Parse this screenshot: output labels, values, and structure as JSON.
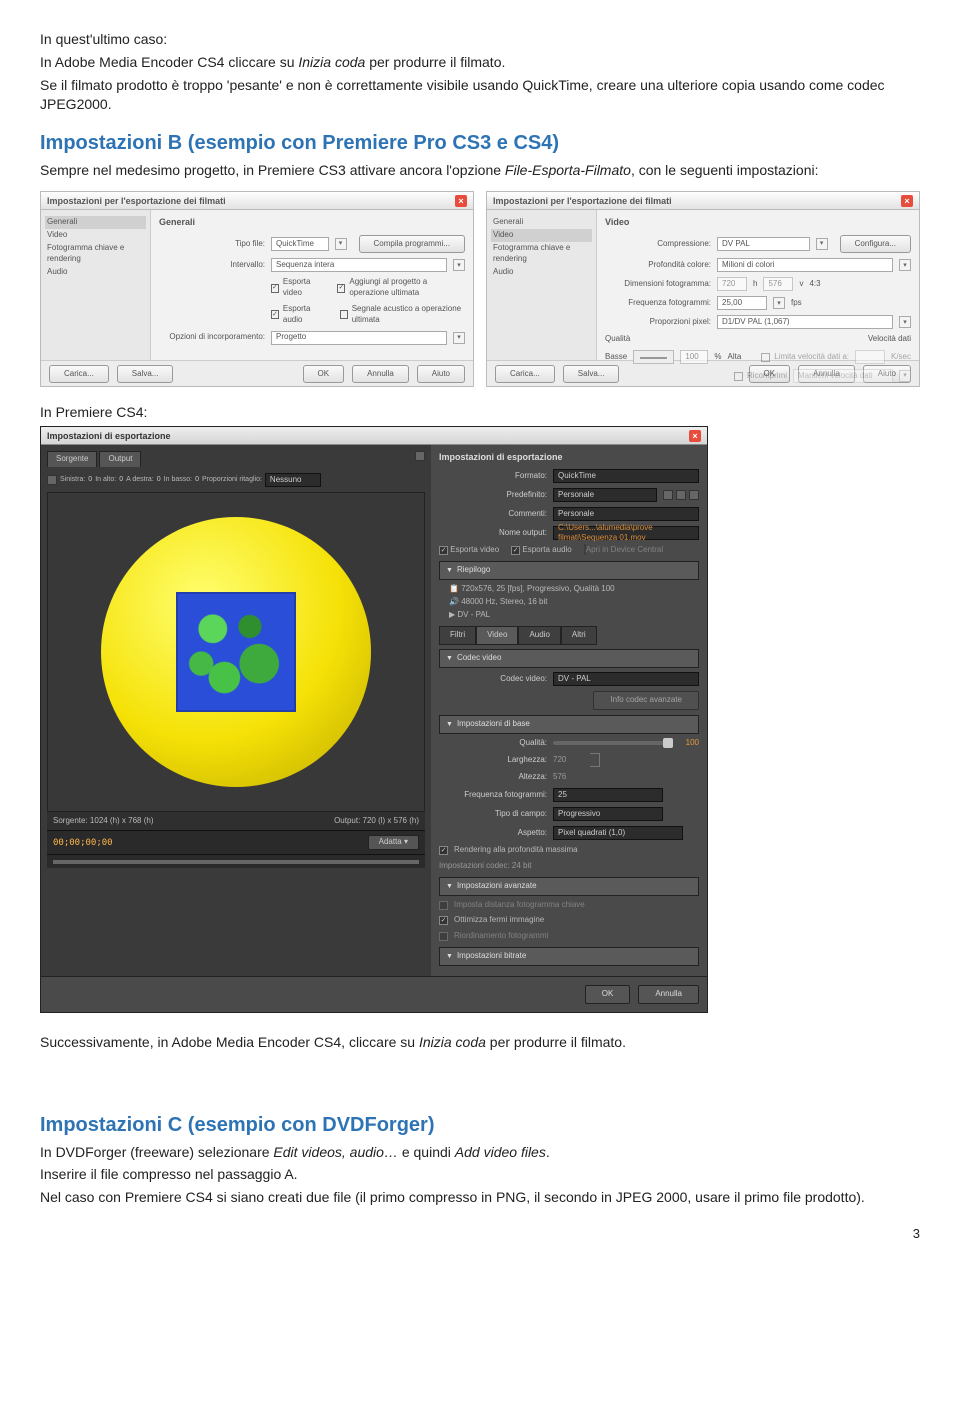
{
  "intro": {
    "l1": "In quest'ultimo caso:",
    "l2a": "In Adobe Media Encoder CS4 cliccare su ",
    "l2b": "Inizia coda",
    "l2c": " per produrre il filmato.",
    "l3": "Se il filmato prodotto è troppo 'pesante' e non è correttamente visibile usando QuickTime, creare una ulteriore copia usando come codec JPEG2000."
  },
  "hB": {
    "title": "Impostazioni B (esempio con Premiere Pro CS3 e CS4)",
    "p1a": "Sempre nel medesimo progetto, in Premiere CS3 attivare ancora l'opzione ",
    "p1b": "File-Esporta-Filmato",
    "p1c": ", con le seguenti impostazioni:"
  },
  "panel1": {
    "title": "Impostazioni per l'esportazione dei filmati",
    "side": {
      "generali": "Generali",
      "video": "Video",
      "kf": "Fotogramma chiave e rendering",
      "audio": "Audio"
    },
    "sub": "Generali",
    "tipo_lbl": "Tipo file:",
    "tipo_val": "QuickTime",
    "int_lbl": "Intervallo:",
    "int_val": "Sequenza intera",
    "chk1": "Esporta video",
    "chk2": "Aggiungi al progetto a operazione ultimata",
    "chk3": "Esporta audio",
    "chk4": "Segnale acustico a operazione ultimata",
    "inc_lbl": "Opzioni di incorporamento:",
    "inc_val": "Progetto",
    "btn_comp": "Compila programmi...",
    "btn_load": "Carica...",
    "btn_save": "Salva...",
    "btn_ok": "OK",
    "btn_cancel": "Annulla",
    "btn_help": "Aiuto"
  },
  "panel2": {
    "title": "Impostazioni per l'esportazione dei filmati",
    "side": {
      "generali": "Generali",
      "video": "Video",
      "kf": "Fotogramma chiave e rendering",
      "audio": "Audio"
    },
    "sub": "Video",
    "comp_lbl": "Compressione:",
    "comp_val": "DV PAL",
    "btn_cfg": "Configura...",
    "prof_lbl": "Profondità colore:",
    "prof_val": "Milioni di colori",
    "dim_lbl": "Dimensioni fotogramma:",
    "dim_h": "720",
    "dim_x": "h",
    "dim_v": "576",
    "dim_v2": "v",
    "dim_ar": "4:3",
    "fps_lbl": "Frequenza fotogrammi:",
    "fps_val": "25,00",
    "fps_unit": "fps",
    "px_lbl": "Proporzioni pixel:",
    "px_val": "D1/DV PAL (1,067)",
    "q_lbl": "Qualità",
    "q_low": "Basse",
    "q_val": "100",
    "q_pct": "%",
    "q_high": "Alta",
    "rate_lbl": "Velocità dati",
    "rate_chk": "Limita velocità dati a:",
    "rate_unit": "K/sec",
    "rec_chk": "Ricomprimi",
    "rec_val": "Mantieni velocità dati",
    "btn_load": "Carica...",
    "btn_save": "Salva...",
    "btn_ok": "OK",
    "btn_cancel": "Annulla",
    "btn_help": "Aiuto"
  },
  "cs4_label": "In Premiere CS4:",
  "cs4": {
    "title": "Impostazioni di esportazione",
    "tab_src": "Sorgente",
    "tab_out": "Output",
    "crop_l": "0",
    "crop_t": "0",
    "crop_r": "0",
    "crop_b": "0",
    "crop_lbl": "Proporzioni ritaglio:",
    "crop_val": "Nessuno",
    "src_lbl": "Sorgente: 1024 (h) x 768 (h)",
    "out_lbl": "Output: 720 (l) x 576 (h)",
    "timecode": "00;00;00;00",
    "fit": "Adatta",
    "r_title": "Impostazioni di esportazione",
    "fmt_lbl": "Formato:",
    "fmt_val": "QuickTime",
    "pre_lbl": "Predefinito:",
    "pre_val": "Personale",
    "cmt_lbl": "Commenti:",
    "cmt_val": "Personale",
    "out_name_lbl": "Nome output:",
    "out_name_val": "C:\\Users...\\alumedia\\prove filmati\\Sequenza 01.mov",
    "exp_v": "Esporta video",
    "exp_a": "Esporta audio",
    "open": "Apri in Device Central",
    "riep": "Riepilogo",
    "riep_v": "720x576, 25 [fps], Progressivo, Qualità 100",
    "riep_a": "48000 Hz, Stereo, 16 bit",
    "riep_c": "DV - PAL",
    "tabs": {
      "filtri": "Filtri",
      "video": "Video",
      "audio": "Audio",
      "altri": "Altri"
    },
    "codec_sec": "Codec video",
    "codec_lbl": "Codec video:",
    "codec_val": "DV - PAL",
    "codec_btn": "Info codec avanzate",
    "base_sec": "Impostazioni di base",
    "q_lbl": "Qualità:",
    "q_val": "100",
    "w_lbl": "Larghezza:",
    "w_val": "720",
    "h_lbl": "Altezza:",
    "h_val": "576",
    "fps_lbl": "Frequenza fotogrammi:",
    "fps_val": "25",
    "field_lbl": "Tipo di campo:",
    "field_val": "Progressivo",
    "asp_lbl": "Aspetto:",
    "asp_val": "Pixel quadrati (1,0)",
    "render_chk": "Rendering alla profondità massima",
    "codec_set": "Impostazioni codec: 24 bit",
    "adv_sec": "Impostazioni avanzate",
    "kf_chk": "Imposta distanza fotogramma chiave",
    "opt_chk": "Ottimizza fermi immagine",
    "rf_chk": "Riordinamento fotogrammi",
    "bit_sec": "Impostazioni bitrate",
    "ok": "OK",
    "cancel": "Annulla"
  },
  "after": {
    "p1a": "Successivamente, in Adobe Media Encoder CS4, cliccare su ",
    "p1b": "Inizia coda",
    "p1c": " per produrre il filmato."
  },
  "hC": {
    "title": "Impostazioni C (esempio con DVDForger)",
    "p1a": "In DVDForger (freeware) selezionare ",
    "p1b": "Edit videos, audio…",
    "p1c": " e quindi ",
    "p1d": "Add video files",
    "p1e": ".",
    "p2": "Inserire il file compresso nel passaggio A.",
    "p3": "Nel caso con Premiere CS4 si siano creati due file (il primo compresso in PNG, il secondo in JPEG 2000, usare il primo file prodotto)."
  },
  "page_number": "3"
}
